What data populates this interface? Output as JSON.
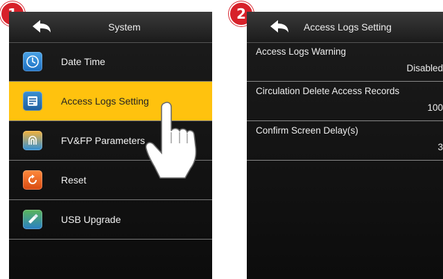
{
  "steps": {
    "step1": "1",
    "step2": "2"
  },
  "screen1": {
    "title": "System",
    "back_icon": "back-arrow-icon",
    "items": [
      {
        "label": "Date Time",
        "icon": "clock-icon"
      },
      {
        "label": "Access Logs Setting",
        "icon": "logs-icon",
        "active": true
      },
      {
        "label": "FV&FP Parameters",
        "icon": "fingerprint-icon"
      },
      {
        "label": "Reset",
        "icon": "reset-icon"
      },
      {
        "label": "USB Upgrade",
        "icon": "usb-icon"
      }
    ]
  },
  "screen2": {
    "title": "Access Logs Setting",
    "back_icon": "back-arrow-icon",
    "settings": [
      {
        "label": "Access Logs Warning",
        "value": "Disabled"
      },
      {
        "label": "Circulation Delete Access Records",
        "value": "100"
      },
      {
        "label": "Confirm Screen Delay(s)",
        "value": "3"
      }
    ]
  },
  "colors": {
    "highlight": "#ffc20e",
    "badge": "#d7212a",
    "screen_bg": "#141414"
  }
}
